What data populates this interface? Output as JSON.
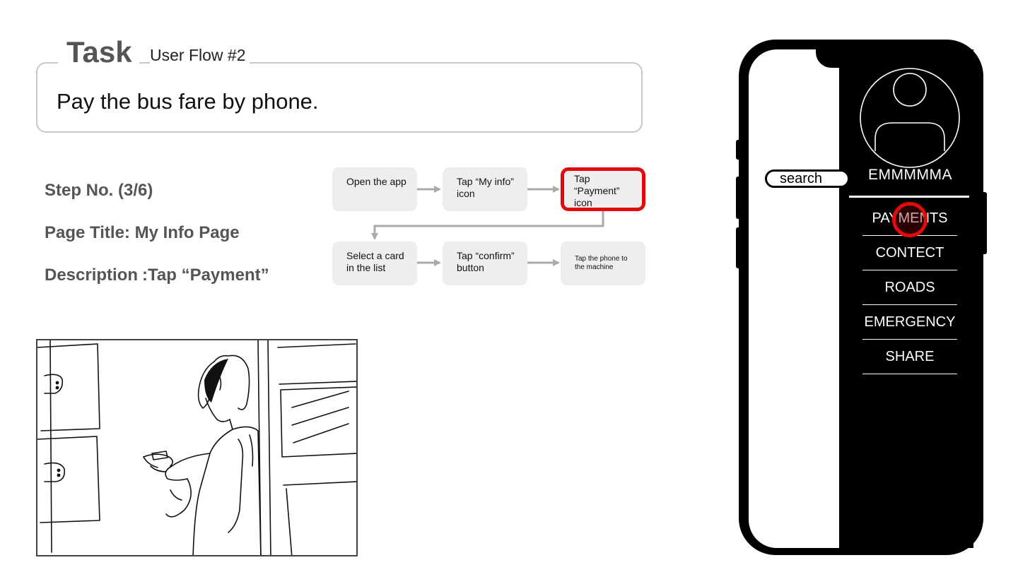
{
  "task": {
    "title": "Task",
    "subtitle": "User Flow #2",
    "text": "Pay the bus fare by phone."
  },
  "step": {
    "number": "Step No. (3/6)",
    "page_title": "Page Title: My Info Page",
    "description_label": "Description",
    "description_value": ":Tap “Payment”"
  },
  "flow": [
    {
      "text": "Open the app"
    },
    {
      "text": "Tap  “My info” icon"
    },
    {
      "text": "Tap “Payment” icon",
      "highlighted": true
    },
    {
      "text": "Select a card in the list"
    },
    {
      "text": "Tap “confirm” button"
    },
    {
      "text": "Tap the phone to the machine"
    }
  ],
  "phone": {
    "search_label": "search",
    "user_name": "EMMMMMA",
    "avatar_icon": "user-avatar-icon",
    "menu": [
      "PAYMENTS",
      "CONTECT",
      "ROADS",
      "EMERGENCY",
      "SHARE"
    ],
    "highlighted_item": "PAYMENTS"
  },
  "colors": {
    "highlight": "#e20b0b",
    "flow_box": "#eeeeee",
    "phone_body": "#000000",
    "label_gray": "#555555"
  }
}
